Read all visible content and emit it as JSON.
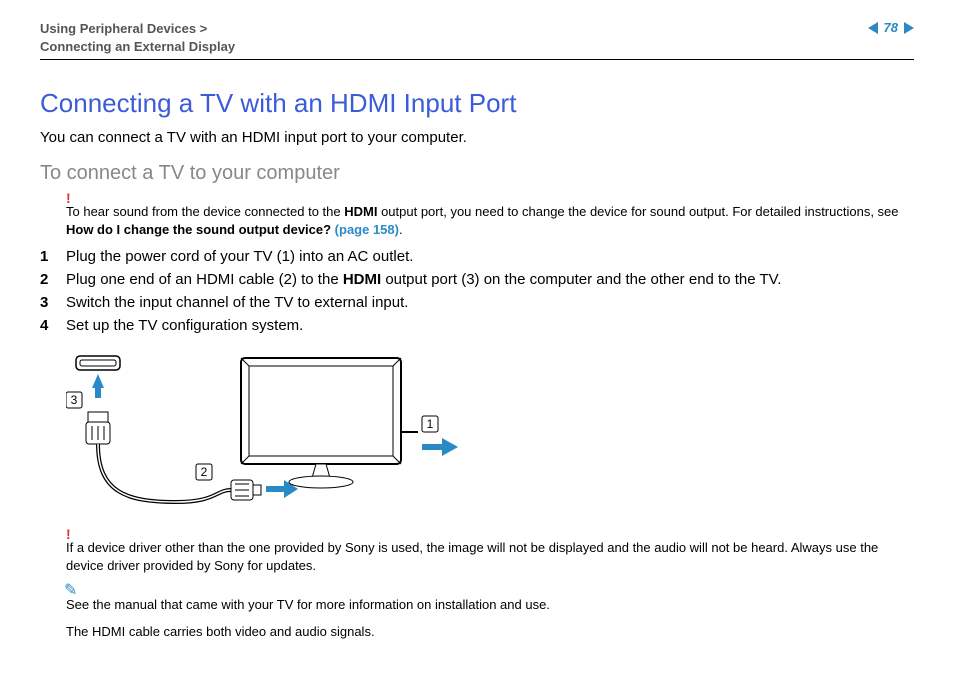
{
  "header": {
    "breadcrumb_line1": "Using Peripheral Devices >",
    "breadcrumb_line2": "Connecting an External Display",
    "page_number": "78"
  },
  "title": "Connecting a TV with an HDMI Input Port",
  "intro": "You can connect a TV with an HDMI input port to your computer.",
  "subtitle": "To connect a TV to your computer",
  "warning1_pre": "To hear sound from the device connected to the ",
  "warning1_bold1": "HDMI",
  "warning1_mid": " output port, you need to change the device for sound output. For detailed instructions, see ",
  "warning1_bold2": "How do I change the sound output device? ",
  "warning1_xref": "(page 158)",
  "warning1_post": ".",
  "steps": [
    {
      "num": "1",
      "pre": "Plug the power cord of your TV (1) into an AC outlet.",
      "bold": "",
      "post": ""
    },
    {
      "num": "2",
      "pre": "Plug one end of an HDMI cable (2) to the ",
      "bold": "HDMI",
      "post": " output port (3) on the computer and the other end to the TV."
    },
    {
      "num": "3",
      "pre": "Switch the input channel of the TV to external input.",
      "bold": "",
      "post": ""
    },
    {
      "num": "4",
      "pre": "Set up the TV configuration system.",
      "bold": "",
      "post": ""
    }
  ],
  "diagram_labels": {
    "l1": "1",
    "l2": "2",
    "l3": "3"
  },
  "warning2": "If a device driver other than the one provided by Sony is used, the image will not be displayed and the audio will not be heard. Always use the device driver provided by Sony for updates.",
  "tip": "See the manual that came with your TV for more information on installation and use.",
  "closing": "The HDMI cable carries both video and audio signals."
}
